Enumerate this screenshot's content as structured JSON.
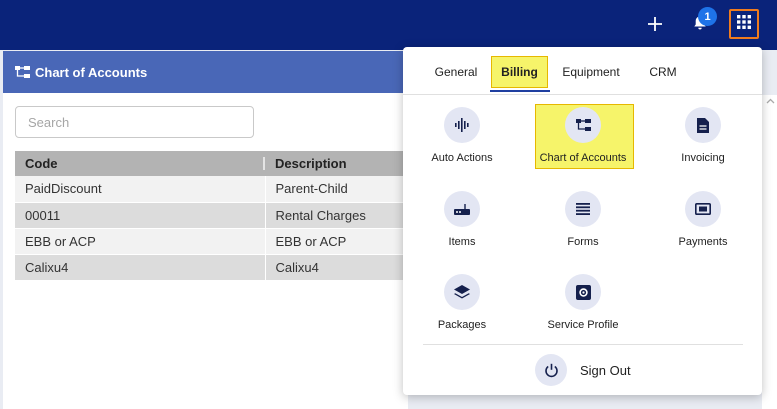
{
  "topbar": {
    "notification_count": "1",
    "icons": [
      "plus-icon",
      "bell-icon",
      "apps-grid-icon"
    ]
  },
  "panel": {
    "title": "Chart of Accounts",
    "search_placeholder": "Search",
    "columns": [
      "Code",
      "Description"
    ],
    "rows": [
      {
        "code": "PaidDiscount",
        "description": "Parent-Child"
      },
      {
        "code": "00011",
        "description": "Rental Charges"
      },
      {
        "code": "EBB or ACP",
        "description": "EBB or ACP"
      },
      {
        "code": "Calixu4",
        "description": "Calixu4"
      }
    ]
  },
  "menu": {
    "tabs": [
      "General",
      "Billing",
      "Equipment",
      "CRM"
    ],
    "active_tab": "Billing",
    "items": [
      "Auto Actions",
      "Chart of Accounts",
      "Invoicing",
      "Items",
      "Forms",
      "Payments",
      "Packages",
      "Service Profile"
    ],
    "highlighted_item": "Chart of Accounts",
    "sign_out": "Sign Out"
  },
  "colors": {
    "topbar": "#0a237a",
    "panel_header": "#4967b7",
    "highlight": "#f6f46a",
    "apps_button_outline": "#f07c1e",
    "badge": "#1e73e8"
  }
}
